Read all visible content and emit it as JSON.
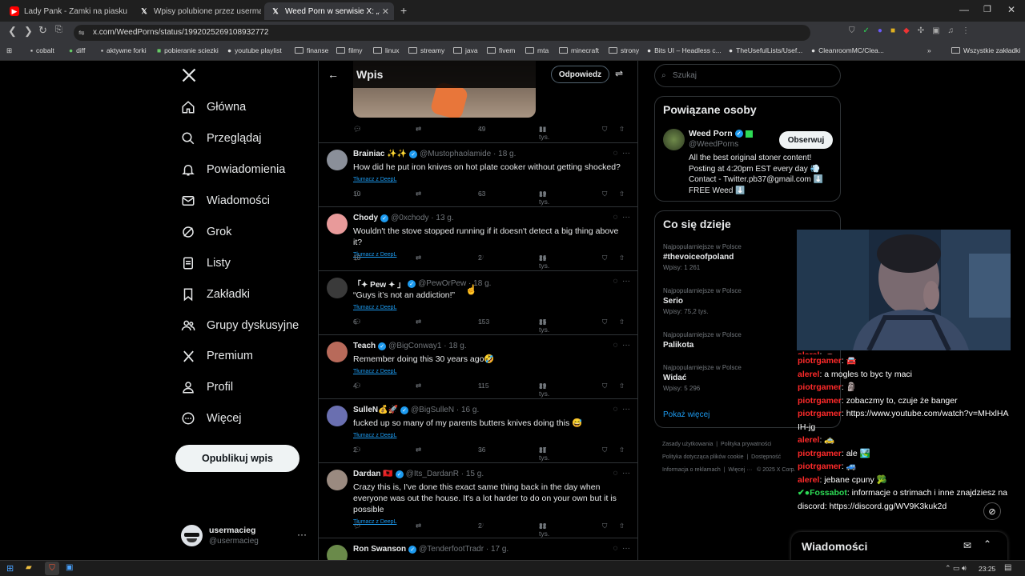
{
  "browser": {
    "tabs": [
      {
        "title": "Lady Pank - Zamki na piasku - Yo",
        "icon": "youtube-icon",
        "color": "#ff0000"
      },
      {
        "title": "Wpisy polubione przez usermacieg (",
        "icon": "x-logo-icon"
      },
      {
        "title": "Weed Porn w serwisie X: „Stoner",
        "icon": "x-logo-icon",
        "active": true
      }
    ],
    "url": "x.com/WeedPorns/status/1992025269108932772",
    "bookmarks": [
      "cobalt",
      "diff",
      "aktywne forki",
      "pobieranie sciezki",
      "youtube playlist",
      "finanse",
      "filmy",
      "linux",
      "streamy",
      "java",
      "fivem",
      "mta",
      "minecraft",
      "strony",
      "Bits UI – Headless c...",
      "TheUsefulLists/Usef...",
      "CleanroomMC/Clea..."
    ],
    "all_bookmarks": "Wszystkie zakładki"
  },
  "nav": {
    "items": [
      {
        "label": "Główna",
        "icon": "home-icon"
      },
      {
        "label": "Przeglądaj",
        "icon": "search-icon"
      },
      {
        "label": "Powiadomienia",
        "icon": "bell-icon"
      },
      {
        "label": "Wiadomości",
        "icon": "mail-icon"
      },
      {
        "label": "Grok",
        "icon": "grok-icon"
      },
      {
        "label": "Listy",
        "icon": "list-icon"
      },
      {
        "label": "Zakładki",
        "icon": "bookmark-icon"
      },
      {
        "label": "Grupy dyskusyjne",
        "icon": "people-icon"
      },
      {
        "label": "Premium",
        "icon": "x-logo-icon"
      },
      {
        "label": "Profil",
        "icon": "person-icon"
      },
      {
        "label": "Więcej",
        "icon": "more-circle-icon"
      }
    ],
    "post_button": "Opublikuj wpis",
    "account": {
      "name": "usermacieg",
      "handle": "@usermacieg"
    }
  },
  "main": {
    "header": {
      "title": "Wpis",
      "reply_button": "Odpowiedz"
    },
    "first_actions": {
      "likes": "49",
      "views": "1 tys."
    },
    "translate_label": "Tłumacz z DeepL",
    "tweets": [
      {
        "name": "Brainiac ✨✨",
        "handle": "@Mustophaolamide · 18 g.",
        "text": "How did he put iron knives on hot plate cooker without getting shocked?",
        "replies": "10",
        "retweets": "",
        "likes": "63",
        "views": "19 tys.",
        "avatar_color": "#8a8f99"
      },
      {
        "name": "Chody",
        "handle": "@0xchody · 13 g.",
        "text": "Wouldn't the stove stopped running if it doesn't detect a big thing above it?",
        "replies": "10",
        "retweets": "",
        "likes": "2",
        "views": "26 tys.",
        "avatar_color": "#e89a9a"
      },
      {
        "name": "「✦ Pew ✦ 」",
        "handle": "@PewOrPew · 18 g.",
        "text": "“Guys it’s not an addiction!”",
        "replies": "6",
        "retweets": "",
        "likes": "153",
        "views": "25 tys.",
        "avatar_color": "#3a3a3a"
      },
      {
        "name": "Teach",
        "handle": "@BigConway1 · 18 g.",
        "text": "Remember doing this 30 years ago🤣",
        "replies": "4",
        "retweets": "",
        "likes": "115",
        "views": "29 tys.",
        "avatar_color": "#b86a5a"
      },
      {
        "name": "SulleN💰🚀",
        "handle": "@BigSulleN · 16 g.",
        "text": "fucked up so many of my parents butters knives doing this 😅",
        "replies": "2",
        "retweets": "",
        "likes": "36",
        "views": "27 tys.",
        "avatar_color": "#6a6fb0"
      },
      {
        "name": "Dardan 🇦🇱",
        "handle": "@Its_DardanR · 15 g.",
        "text": "Crazy this is, I've done this exact same thing back in the day when everyone was out the house. It's a lot harder to do on your own but it is possible",
        "replies": "",
        "retweets": "",
        "likes": "2",
        "views": "22 tys.",
        "avatar_color": "#9a8a80"
      },
      {
        "name": "Ron Swanson",
        "handle": "@TenderfootTradr · 17 g.",
        "text": "",
        "replies": "",
        "retweets": "",
        "likes": "",
        "views": "",
        "avatar_color": "#6a8a4a"
      }
    ]
  },
  "right": {
    "search_placeholder": "Szukaj",
    "related": {
      "title": "Powiązane osoby",
      "name": "Weed Porn",
      "handle": "@WeedPorns",
      "follow": "Obserwuj",
      "bio": [
        "All the best original stoner content!",
        "Posting at 4:20pm EST every day 💨",
        "Contact - Twitter.pb37@gmail.com ⬇️",
        "FREE Weed ⬇️"
      ]
    },
    "trends": {
      "title": "Co się dzieje",
      "items": [
        {
          "context": "Najpopularniejsze w Polsce",
          "name": "#thevoiceofpoland",
          "count": "Wpisy: 1 261"
        },
        {
          "context": "Najpopularniejsze w Polsce",
          "name": "Serio",
          "count": "Wpisy: 75,2 tys."
        },
        {
          "context": "Najpopularniejsze w Polsce",
          "name": "Palikota",
          "count": ""
        },
        {
          "context": "Najpopularniejsze w Polsce",
          "name": "Widać",
          "count": "Wpisy: 5 296"
        }
      ],
      "show_more": "Pokaż więcej"
    },
    "footer": [
      "Zasady użytkowania",
      "Polityka prywatności",
      "Polityka dotycząca plików cookie",
      "Dostępność",
      "Informacja o reklamach",
      "Więcej ···",
      "© 2025 X Corp."
    ]
  },
  "stream_chat": [
    {
      "user": "alerel",
      "msg": "🚗"
    },
    {
      "user": "piotrgamer",
      "msg": "🚘"
    },
    {
      "user": "alerel",
      "msg": "a mogles to byc ty maci"
    },
    {
      "user": "piotrgamer",
      "msg": "🗿"
    },
    {
      "user": "piotrgamer",
      "msg": "zobaczmy to, czuje że banger"
    },
    {
      "user": "piotrgamer",
      "msg": "https://www.youtube.com/watch?v=MHxlHAIH-jg"
    },
    {
      "user": "alerel",
      "msg": "🚕"
    },
    {
      "user": "piotrgamer",
      "msg": "ale 🏞️"
    },
    {
      "user": "piotrgamer",
      "msg": "🚙"
    },
    {
      "user": "alerel",
      "msg": "jebane cpuny 🥦"
    },
    {
      "user": "✔●Fossabot",
      "msg": "informacje o strimach i inne znajdziesz na discord: https://discord.gg/WV9K3kuk2d",
      "bot": true
    }
  ],
  "dm_bar": {
    "title": "Wiadomości"
  },
  "taskbar": {
    "time": "23:25"
  },
  "colors": {
    "accent": "#1d9bf0",
    "chat_user": "#ff2a2a",
    "bot": "#2ddb55"
  }
}
